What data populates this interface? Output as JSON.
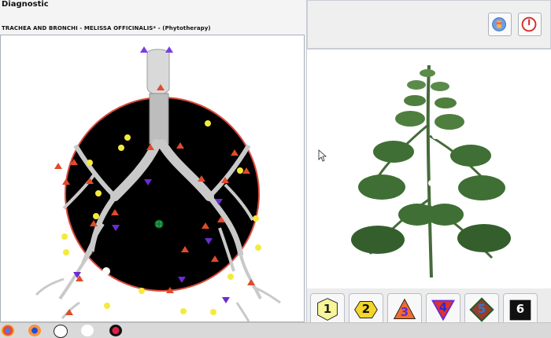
{
  "window": {
    "title": "Diagnostic",
    "subtitle": "TRACHEA  AND  BRONCHI  -  MELISSA  OFFICINALIS*  -  (Phytotherapy)"
  },
  "right_toolbar": {
    "buttons": [
      {
        "name": "analysis-icon",
        "label": ""
      },
      {
        "name": "power-icon",
        "label": ""
      }
    ]
  },
  "legend_buttons": [
    {
      "label": "1",
      "shape": "hexagon",
      "fill": "#f8f59a",
      "text_color": "#222"
    },
    {
      "label": "2",
      "shape": "hexagon",
      "fill": "#f2d62a",
      "text_color": "#111"
    },
    {
      "label": "3",
      "shape": "triangle-up",
      "fill": "#f26c2a",
      "text_color": "#6a2bd1"
    },
    {
      "label": "4",
      "shape": "triangle-down",
      "fill": "#e0312d",
      "text_color": "#2b2bd1"
    },
    {
      "label": "5",
      "shape": "diamond",
      "fill": "#9a3b2b",
      "text_color": "#2b7bd1"
    },
    {
      "label": "6",
      "shape": "square",
      "fill": "#111111",
      "text_color": "#ffffff"
    }
  ],
  "icons": {
    "analysis": "analysis-icon",
    "power": "power-icon",
    "cursor": "mouse-cursor-icon"
  },
  "colors": {
    "bg": "#f1f1f1",
    "viewer_bg": "#ffffff",
    "lung_bg": "#000000",
    "accent_red": "#d9332c",
    "marker_yellow": "#f4ea3e"
  }
}
